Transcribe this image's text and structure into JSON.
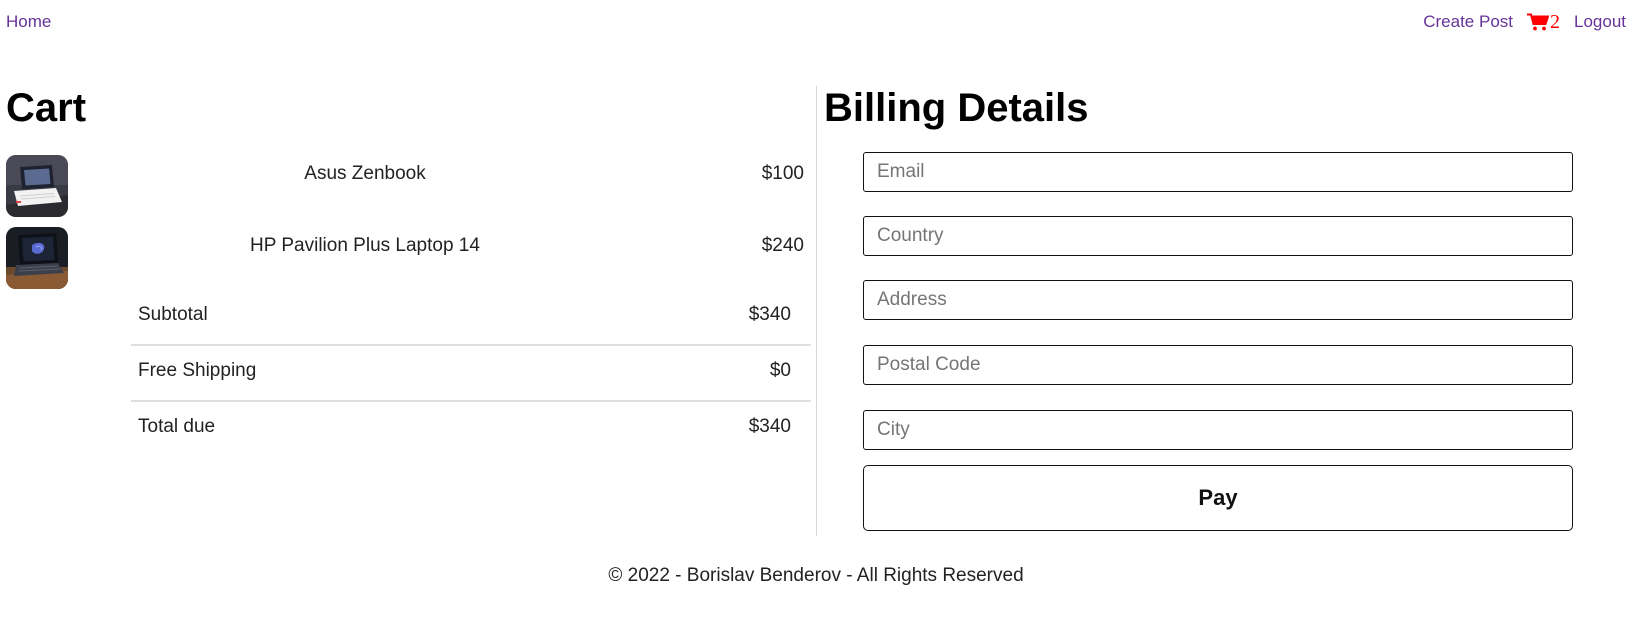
{
  "nav": {
    "home_label": "Home",
    "create_post_label": "Create Post",
    "cart_count": "2",
    "logout_label": "Logout",
    "link_color": "#663399",
    "cart_color": "#ff0000"
  },
  "cart": {
    "title": "Cart",
    "items": [
      {
        "name": "Asus Zenbook",
        "price": "$100",
        "image": "laptop-photo"
      },
      {
        "name": "HP Pavilion Plus Laptop 14",
        "price": "$240",
        "image": "laptop-photo"
      }
    ],
    "summary": {
      "subtotal_label": "Subtotal",
      "subtotal_value": "$340",
      "shipping_label": "Free Shipping",
      "shipping_value": "$0",
      "total_label": "Total due",
      "total_value": "$340"
    }
  },
  "billing": {
    "title": "Billing Details",
    "email_placeholder": "Email",
    "email_value": "",
    "country_placeholder": "Country",
    "country_value": "",
    "address_placeholder": "Address",
    "address_value": "",
    "postal_code_placeholder": "Postal Code",
    "postal_code_value": "",
    "city_placeholder": "City",
    "city_value": "",
    "pay_label": "Pay"
  },
  "footer": {
    "text": "© 2022 - Borislav Benderov - All Rights Reserved"
  }
}
